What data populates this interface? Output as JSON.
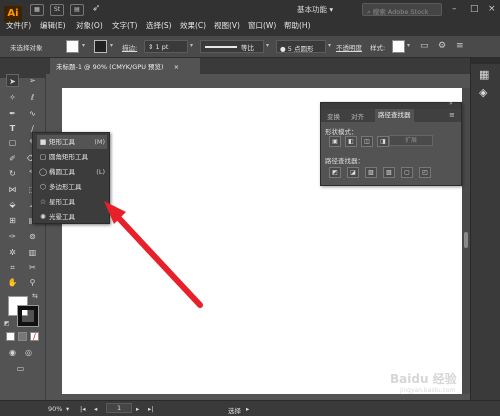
{
  "app": {
    "logo": "Ai"
  },
  "menu": [
    "文件(F)",
    "编辑(E)",
    "对象(O)",
    "文字(T)",
    "选择(S)",
    "效果(C)",
    "视图(V)",
    "窗口(W)",
    "帮助(H)"
  ],
  "titlebar": {
    "st_label": "St",
    "workspace": "基本功能",
    "search_placeholder": "搜索 Adobe Stock"
  },
  "controlbar": {
    "selection_status": "未选择对象",
    "stroke_label": "描边:",
    "stroke_value": "1 pt",
    "stroke_profile": "等比",
    "brush_value": "5 点圆形",
    "opacity_label": "不透明度",
    "style_label": "样式:"
  },
  "document": {
    "tab_title": "未标题-1 @ 90% (CMYK/GPU 预览)",
    "close_glyph": "×"
  },
  "flyout": {
    "items": [
      {
        "label": "矩形工具",
        "key": "(M)"
      },
      {
        "label": "圆角矩形工具",
        "key": ""
      },
      {
        "label": "椭圆工具",
        "key": "(L)"
      },
      {
        "label": "多边形工具",
        "key": ""
      },
      {
        "label": "星形工具",
        "key": ""
      },
      {
        "label": "光晕工具",
        "key": ""
      }
    ]
  },
  "pathfinder": {
    "tabs": [
      "变换",
      "对齐",
      "路径查找器"
    ],
    "shape_modes_label": "形状模式：",
    "expand_label": "扩展",
    "pathfinders_label": "路径查找器："
  },
  "status": {
    "zoom": "90%",
    "page": "1",
    "mode": "选择"
  },
  "watermark": {
    "brand": "Baidu 经验",
    "url": "jingyan.baidu.com"
  },
  "colors": {
    "accent_arrow": "#e8202a",
    "logo_text": "#ff9a00"
  }
}
